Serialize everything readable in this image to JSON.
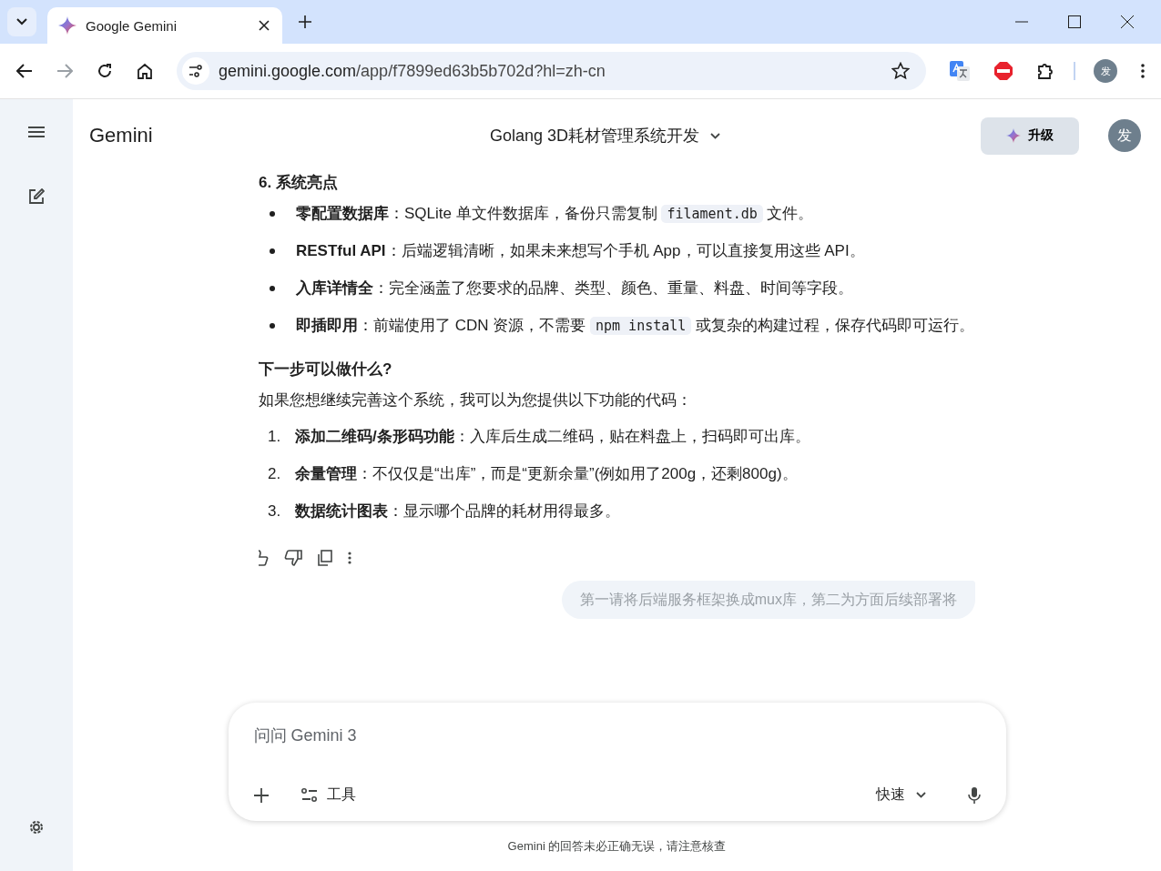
{
  "browser": {
    "tab_title": "Google Gemini",
    "url_host": "gemini.google.com",
    "url_path": "/app/f7899ed63b5b702d?hl=zh-cn",
    "profile_initial": "发"
  },
  "header": {
    "brand": "Gemini",
    "conversation_title": "Golang 3D耗材管理系统开发",
    "upgrade_label": "升级",
    "avatar_initial": "发"
  },
  "response": {
    "heading": "6. 系统亮点",
    "bullets": [
      [
        {
          "kind": "bold",
          "text": "零配置数据库"
        },
        {
          "kind": "text",
          "text": "：SQLite 单文件数据库，备份只需复制 "
        },
        {
          "kind": "code",
          "text": "filament.db"
        },
        {
          "kind": "text",
          "text": " 文件。"
        }
      ],
      [
        {
          "kind": "bold",
          "text": "RESTful API"
        },
        {
          "kind": "text",
          "text": "：后端逻辑清晰，如果未来想写个手机 App，可以直接复用这些 API。"
        }
      ],
      [
        {
          "kind": "bold",
          "text": "入库详情全"
        },
        {
          "kind": "text",
          "text": "：完全涵盖了您要求的品牌、类型、颜色、重量、料盘、时间等字段。"
        }
      ],
      [
        {
          "kind": "bold",
          "text": "即插即用"
        },
        {
          "kind": "text",
          "text": "：前端使用了 CDN 资源，不需要 "
        },
        {
          "kind": "code",
          "text": "npm install"
        },
        {
          "kind": "text",
          "text": " 或复杂的构建过程，保存代码即可运行。"
        }
      ]
    ],
    "next_heading": "下一步可以做什么?",
    "intro": "如果您想继续完善这个系统，我可以为您提供以下功能的代码：",
    "steps": [
      {
        "number": "1.",
        "title": "添加二维码/条形码功能",
        "text": "：入库后生成二维码，贴在料盘上，扫码即可出库。"
      },
      {
        "number": "2.",
        "title": "余量管理",
        "text": "：不仅仅是“出库”，而是“更新余量”(例如用了200g，还剩800g)。"
      },
      {
        "number": "3.",
        "title": "数据统计图表",
        "text": "：显示哪个品牌的耗材用得最多。"
      }
    ]
  },
  "user_message": "第一请将后端服务框架换成mux库，第二为方面后续部署将",
  "composer": {
    "placeholder": "问问 Gemini 3",
    "tools_label": "工具",
    "mode_label": "快速"
  },
  "disclaimer": "Gemini 的回答未必正确无误，请注意核查"
}
